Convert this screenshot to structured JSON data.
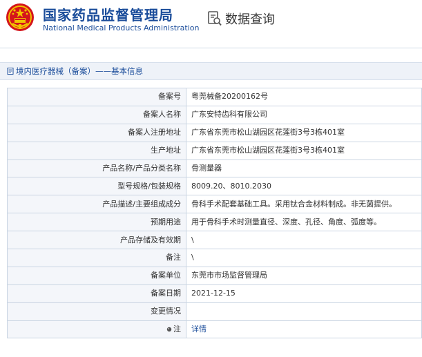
{
  "header": {
    "title_cn": "国家药品监督管理局",
    "title_en": "National Medical Products Administration",
    "query_label": "数据查询",
    "emblem_icon": "national-emblem-icon",
    "query_icon": "document-search-icon"
  },
  "breadcrumb": {
    "icon": "page-icon",
    "text": "境内医疗器械（备案）——基本信息"
  },
  "details": {
    "rows": [
      {
        "label": "备案号",
        "value": "粤莞械备20200162号"
      },
      {
        "label": "备案人名称",
        "value": "广东安特齿科有限公司"
      },
      {
        "label": "备案人注册地址",
        "value": "广东省东莞市松山湖园区花莲街3号3栋401室"
      },
      {
        "label": "生产地址",
        "value": "广东省东莞市松山湖园区花莲街3号3栋401室"
      },
      {
        "label": "产品名称/产品分类名称",
        "value": "骨测量器"
      },
      {
        "label": "型号规格/包装规格",
        "value": "8009.20、8010.2030"
      },
      {
        "label": "产品描述/主要组成成分",
        "value": "骨科手术配套基础工具。采用钛合金材料制成。非无菌提供。"
      },
      {
        "label": "预期用途",
        "value": "用于骨科手术时测量直径、深度、孔径、角度、弧度等。"
      },
      {
        "label": "产品存储及有效期",
        "value": "\\"
      },
      {
        "label": "备注",
        "value": "\\"
      },
      {
        "label": "备案单位",
        "value": "东莞市市场监督管理局"
      },
      {
        "label": "备案日期",
        "value": "2021-12-15"
      },
      {
        "label": "变更情况",
        "value": ""
      },
      {
        "label": "注",
        "value": "详情",
        "is_link": true
      }
    ]
  },
  "colors": {
    "brand_blue": "#1a4c9a",
    "emblem_red": "#d4141b",
    "emblem_gold": "#f2c200",
    "label_bg": "#f4f6fa",
    "border": "#c9d4e2"
  }
}
